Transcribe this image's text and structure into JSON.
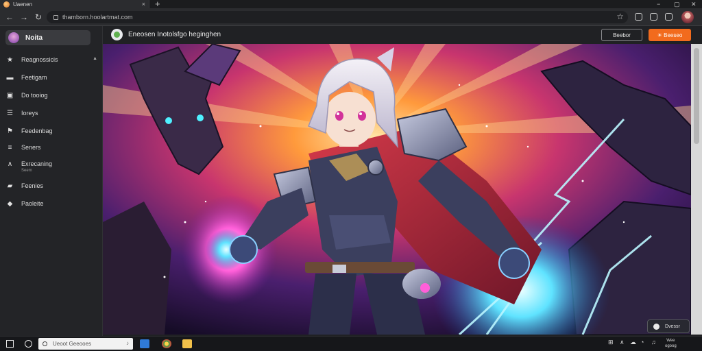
{
  "browser": {
    "tab_title": "Uaenen",
    "tab_close": "×",
    "new_tab": "+",
    "window_controls": {
      "minimize": "−",
      "maximize": "▢",
      "close": "✕"
    },
    "url": "thamborn.hoolartmat.com",
    "nav": {
      "back": "←",
      "forward": "→",
      "reload": "↻"
    },
    "bookmark_star": "☆"
  },
  "sidebar": {
    "title": "Noita",
    "items": [
      {
        "label": "Reagnossicis",
        "icon": "pin-icon",
        "glyph": "★",
        "has_caret": true
      },
      {
        "label": "Feetigam",
        "icon": "folder-icon",
        "glyph": "▬"
      },
      {
        "label": "Do tooiog",
        "icon": "card-icon",
        "glyph": "▣"
      },
      {
        "label": "Ioreys",
        "icon": "list-icon",
        "glyph": "☰"
      },
      {
        "label": "Feedenbag",
        "icon": "flag-icon",
        "glyph": "⚑"
      },
      {
        "label": "Seners",
        "icon": "lines-icon",
        "glyph": "≡"
      },
      {
        "label": "Exrecaning",
        "icon": "chevron-up-icon",
        "glyph": "∧",
        "sub": "Seem"
      },
      {
        "label": "Feenies",
        "icon": "bookmark-icon",
        "glyph": "▰"
      },
      {
        "label": "Paoleite",
        "icon": "gem-icon",
        "glyph": "◆"
      }
    ]
  },
  "page": {
    "title": "Eneosen Inotolsfgo heginghen",
    "outline_button": "Beebor",
    "primary_button": "☀ Beeseo",
    "badge": "Dvessr"
  },
  "taskbar": {
    "search_placeholder": "Ueoot Geeooes",
    "clock_time": "Wee",
    "clock_date": "ogoog"
  },
  "colors": {
    "accent": "#f26b1d",
    "background": "#202124",
    "sidebar": "#232427"
  }
}
